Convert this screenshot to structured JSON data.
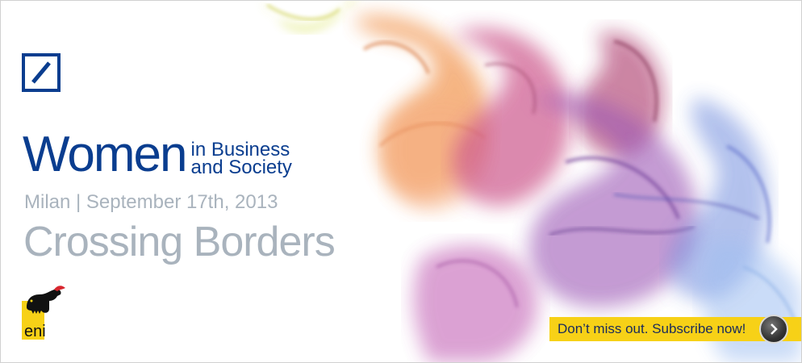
{
  "banner": {
    "headline_big": "Women",
    "headline_sub_line1": "in Business",
    "headline_sub_line2": "and Society",
    "date_line": "Milan | September 17th, 2013",
    "tagline": "Crossing Borders",
    "subscribe_label": "Don’t miss out. Subscribe now!",
    "sponsor_logo_text": "eni"
  },
  "colors": {
    "brand_blue": "#0a3d8f",
    "muted_gray": "#a9b3bd",
    "cta_yellow": "#f7d117"
  },
  "icons": {
    "bank_logo": "deutsche-bank-logo-icon",
    "sponsor_logo": "eni-six-legged-dog-icon",
    "cta_arrow": "chevron-right-icon"
  }
}
